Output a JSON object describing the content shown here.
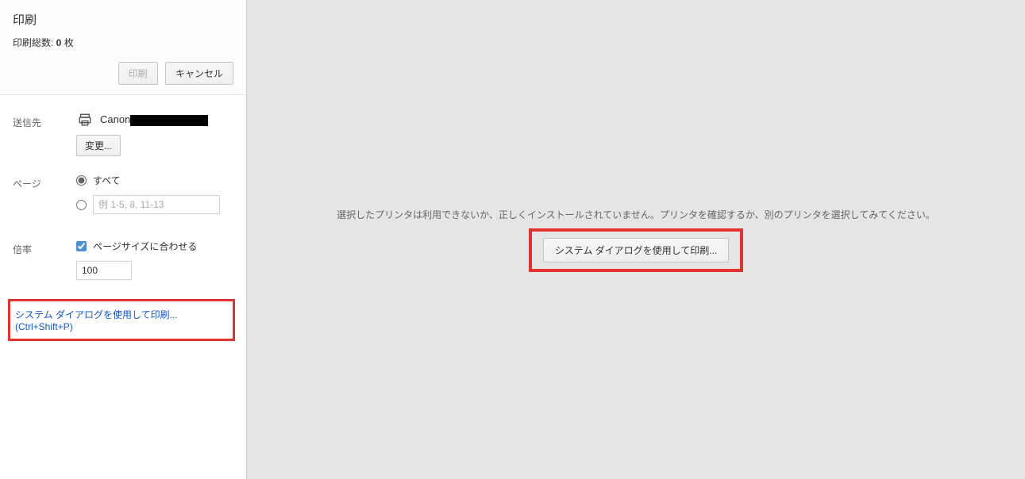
{
  "header": {
    "title": "印刷",
    "summary_prefix": "印刷総数: ",
    "summary_count": "0",
    "summary_suffix": " 枚",
    "print_btn": "印刷",
    "cancel_btn": "キャンセル"
  },
  "destination": {
    "label": "送信先",
    "printer_name_prefix": "Canon",
    "change_btn": "変更..."
  },
  "pages": {
    "label": "ページ",
    "all_label": "すべて",
    "range_placeholder": "例 1-5, 8, 11-13"
  },
  "scale": {
    "label": "倍率",
    "fit_label": "ページサイズに合わせる",
    "value": "100"
  },
  "system_dialog": {
    "link_text": "システム ダイアログを使用して印刷...",
    "shortcut": "(Ctrl+Shift+P)"
  },
  "preview": {
    "error_text": "選択したプリンタは利用できないか、正しくインストールされていません。プリンタを確認するか、別のプリンタを選択してみてください。",
    "sysdlg_btn": "システム ダイアログを使用して印刷..."
  }
}
